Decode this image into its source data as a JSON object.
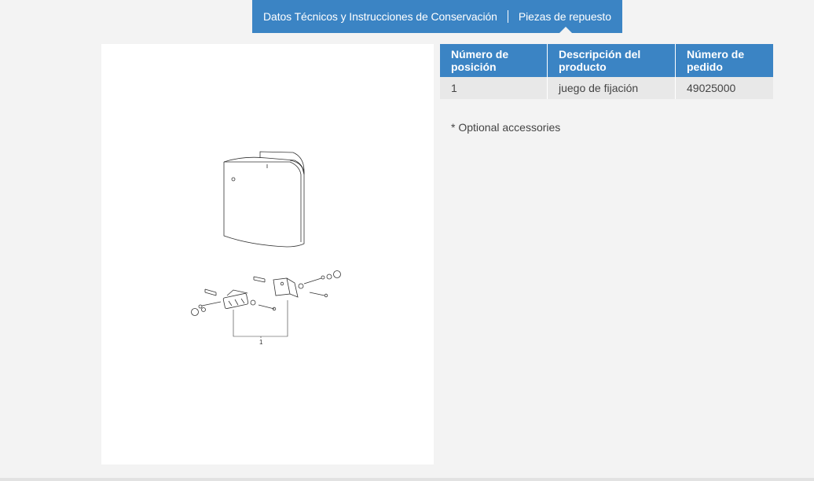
{
  "tabs": {
    "technical": "Datos Técnicos y Instrucciones de Conservación",
    "spare_parts": "Piezas de repuesto"
  },
  "diagram": {
    "callout": "1"
  },
  "parts_table": {
    "headers": {
      "position_line1": "Número de",
      "position_line2": "posición",
      "description_line1": "Descripción del",
      "description_line2": "producto",
      "order_line1": "Número de",
      "order_line2": "pedido"
    },
    "rows": [
      {
        "position": "1",
        "description": "juego de fijación",
        "order_number": "49025000"
      }
    ]
  },
  "note": "* Optional accessories",
  "colors": {
    "accent": "#3b84c4",
    "row_background": "#e8e8e8",
    "page_background": "#f3f3f3"
  }
}
